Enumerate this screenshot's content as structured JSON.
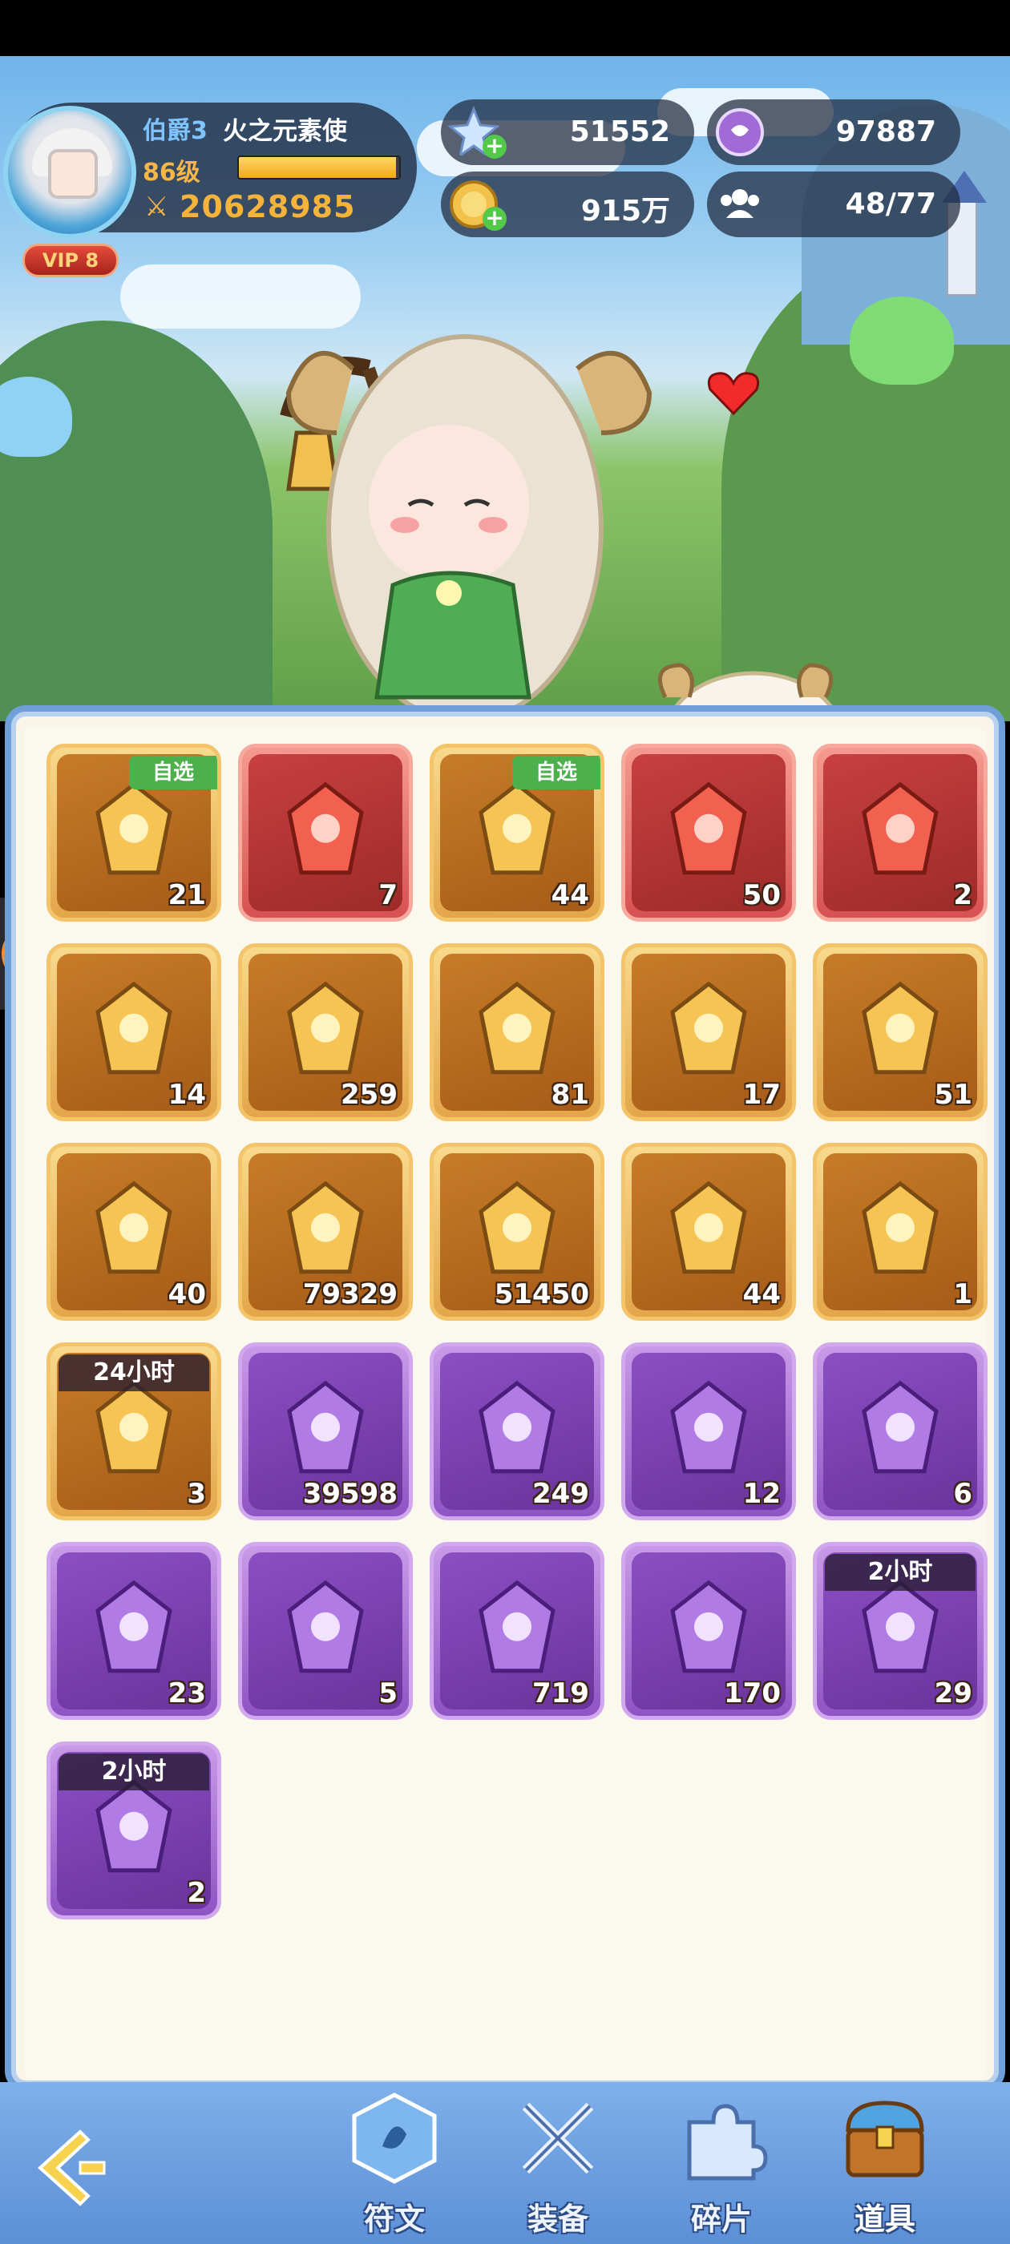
{
  "player": {
    "title": "伯爵3",
    "name": "火之元素使",
    "level": "86级",
    "exp_fraction": 0.98,
    "power": "20628985",
    "vip": "VIP 8"
  },
  "resources": {
    "stars": "51552",
    "gems": "97887",
    "gold": "915万",
    "team": "48/77"
  },
  "inventory": [
    {
      "name": "selectable-gift-box",
      "rarity": "gold",
      "count": "21",
      "tag": "自选"
    },
    {
      "name": "red-crystal",
      "rarity": "red",
      "count": "7"
    },
    {
      "name": "selectable-gift-box",
      "rarity": "gold",
      "count": "44",
      "tag": "自选"
    },
    {
      "name": "summon-ticket",
      "rarity": "red",
      "count": "50"
    },
    {
      "name": "fire-egg",
      "rarity": "red",
      "count": "2"
    },
    {
      "name": "gold-crystal",
      "rarity": "gold",
      "count": "14"
    },
    {
      "name": "scroll-ticket",
      "rarity": "gold",
      "count": "259"
    },
    {
      "name": "blue-star-shard",
      "rarity": "gold",
      "count": "81"
    },
    {
      "name": "green-crystal",
      "rarity": "gold",
      "count": "17"
    },
    {
      "name": "heart-ticket",
      "rarity": "gold",
      "count": "51"
    },
    {
      "name": "lightning-potion",
      "rarity": "gold",
      "count": "40"
    },
    {
      "name": "gold-coin-token",
      "rarity": "gold",
      "count": "79329"
    },
    {
      "name": "purple-coin-token",
      "rarity": "gold",
      "count": "51450"
    },
    {
      "name": "dragon-egg",
      "rarity": "gold",
      "count": "44"
    },
    {
      "name": "swap-potion",
      "rarity": "gold",
      "count": "1"
    },
    {
      "name": "treasure-chest",
      "rarity": "gold",
      "count": "3",
      "timer": "24小时"
    },
    {
      "name": "diamond",
      "rarity": "purple",
      "count": "39598"
    },
    {
      "name": "hourglass",
      "rarity": "purple",
      "count": "249"
    },
    {
      "name": "ice-crystal",
      "rarity": "purple",
      "count": "12"
    },
    {
      "name": "purple-crystal",
      "rarity": "purple",
      "count": "6"
    },
    {
      "name": "sword-card",
      "rarity": "purple",
      "count": "23"
    },
    {
      "name": "refresh-card",
      "rarity": "purple",
      "count": "5"
    },
    {
      "name": "crystal-orb",
      "rarity": "purple",
      "count": "719"
    },
    {
      "name": "purple-egg",
      "rarity": "purple",
      "count": "170"
    },
    {
      "name": "coin-pile",
      "rarity": "purple",
      "count": "29",
      "timer": "2小时"
    },
    {
      "name": "green-potion",
      "rarity": "purple",
      "count": "2",
      "timer": "2小时"
    }
  ],
  "nav": {
    "runes": "符文",
    "equipment": "装备",
    "fragments": "碎片",
    "items": "道具"
  },
  "colors": {
    "gold_slot": "#e3a64a",
    "red_slot": "#d75151",
    "purple_slot": "#8e54c4",
    "panel_border": "#6e9fd8"
  }
}
